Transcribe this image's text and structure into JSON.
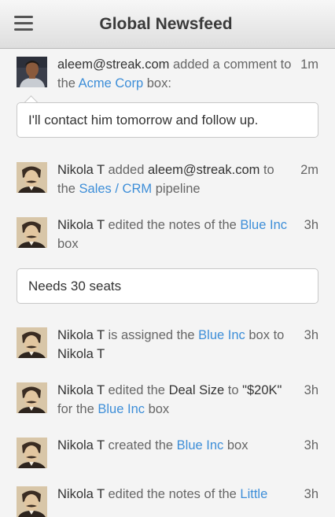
{
  "header": {
    "title": "Global Newsfeed",
    "menu_icon": "hamburger-menu-icon"
  },
  "feed": [
    {
      "avatar": "aleem-avatar",
      "user": "aleem@streak.com",
      "t1": " added a comment to the ",
      "link": "Acme Corp",
      "t2": " box:",
      "time": "1m",
      "comment": "I'll contact him tomorrow and follow up."
    },
    {
      "avatar": "nikola-avatar",
      "user": "Nikola T",
      "t1": " added ",
      "strong2": "aleem@streak.com",
      "t2": " to the ",
      "link": "Sales / CRM",
      "t3": " pipeline",
      "time": "2m"
    },
    {
      "avatar": "nikola-avatar",
      "user": "Nikola T",
      "t1": " edited the notes of the ",
      "link": "Blue Inc",
      "t2": " box",
      "time": "3h",
      "comment": "Needs 30 seats"
    },
    {
      "avatar": "nikola-avatar",
      "user": "Nikola T",
      "t1": " is assigned the ",
      "link": "Blue Inc",
      "t2": " box to ",
      "strong2": "Nikola T",
      "time": "3h"
    },
    {
      "avatar": "nikola-avatar",
      "user": "Nikola T",
      "t1": " edited the ",
      "strong2": "Deal Size",
      "t2": " to ",
      "strong3": "\"$20K\"",
      "t3": " for the ",
      "link": "Blue Inc",
      "t4": " box",
      "time": "3h"
    },
    {
      "avatar": "nikola-avatar",
      "user": "Nikola T",
      "t1": " created the ",
      "link": "Blue Inc",
      "t2": " box",
      "time": "3h"
    },
    {
      "avatar": "nikola-avatar",
      "user": "Nikola T",
      "t1": " edited the notes of the ",
      "link": "Little",
      "time": "3h"
    }
  ]
}
